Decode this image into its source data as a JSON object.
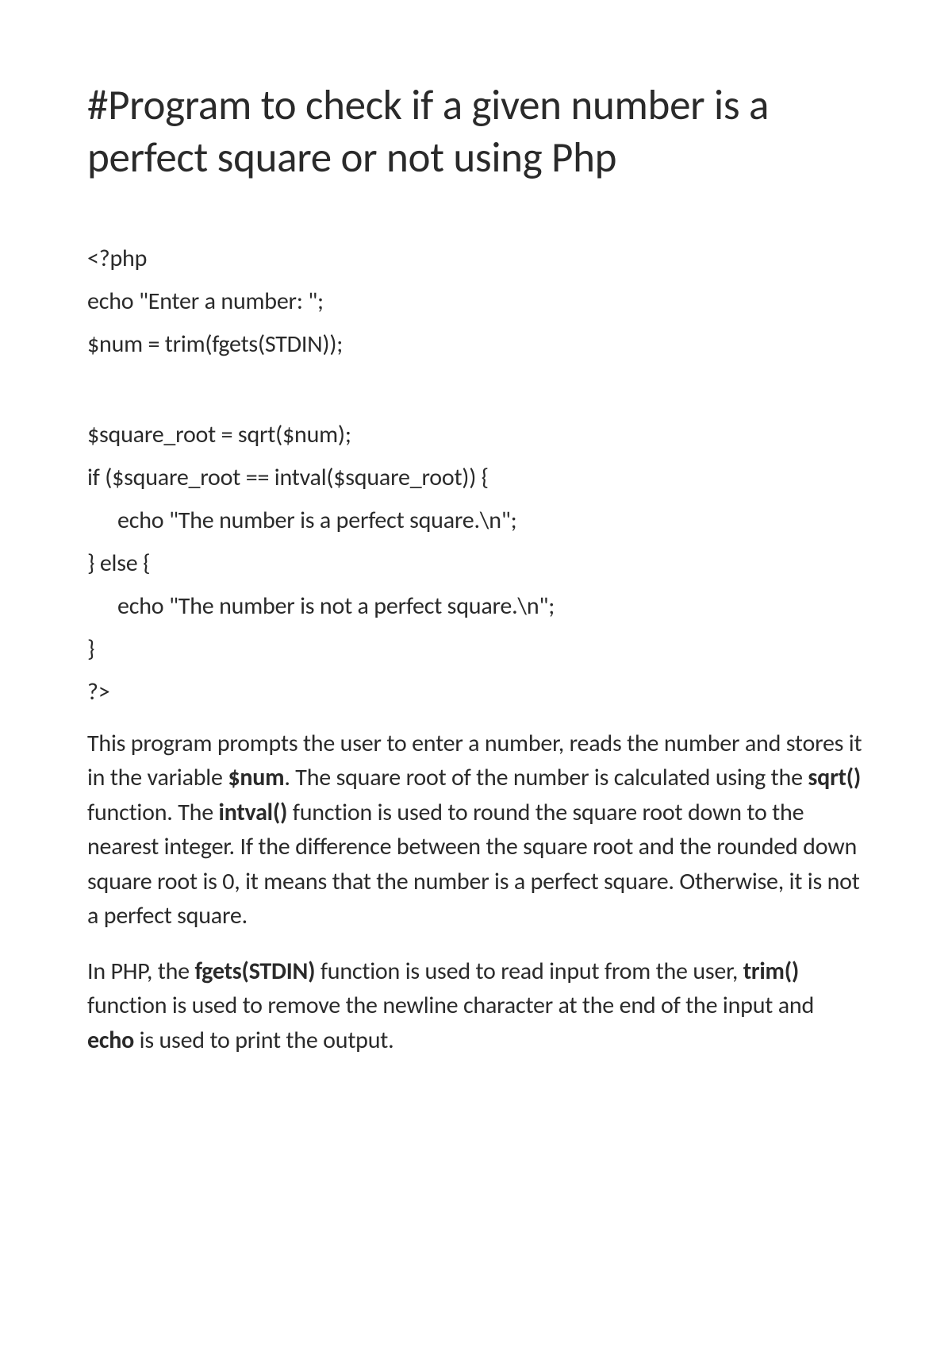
{
  "heading": "#Program to check if a given number is a perfect square or not using Php",
  "code": {
    "line1": "<?php",
    "line2": "echo \"Enter a number: \";",
    "line3": "$num = trim(fgets(STDIN));",
    "line4": "$square_root = sqrt($num);",
    "line5": "if ($square_root == intval($square_root)) {",
    "line6": "echo \"The number is a perfect square.\\n\";",
    "line7": "} else {",
    "line8": "echo \"The number is not a perfect square.\\n\";",
    "line9": "}",
    "line10": "?>"
  },
  "para1": {
    "t1": "This program prompts the user to enter a number, reads the number and stores it in the variable ",
    "b1": "$num",
    "t2": ". The square root of the number is calculated using the ",
    "b2": "sqrt()",
    "t3": " function. The ",
    "b3": "intval()",
    "t4": " function is used to round the square root down to the nearest integer. If the difference between the square root and the rounded down square root is 0, it means that the number is a perfect square. Otherwise, it is not a perfect square."
  },
  "para2": {
    "t1": "In PHP, the ",
    "b1": "fgets(STDIN)",
    "t2": " function is used to read input from the user, ",
    "b2": "trim()",
    "t3": " function is used to remove the newline character at the end of the input and ",
    "b3": "echo",
    "t4": " is used to print the output."
  }
}
